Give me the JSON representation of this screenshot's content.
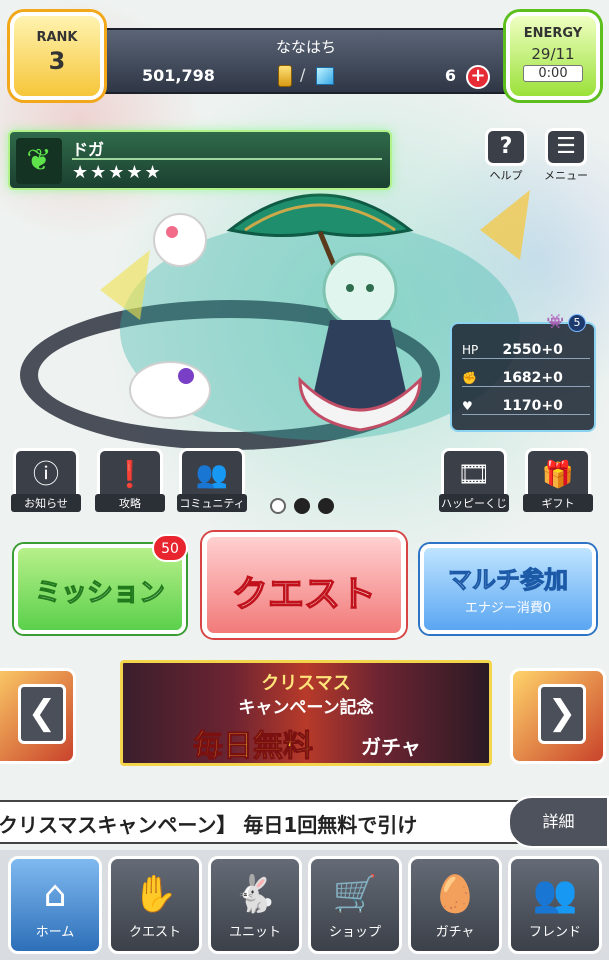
{
  "header": {
    "rank_label": "RANK",
    "rank_value": "3",
    "player_name": "ななはち",
    "money": "501,798",
    "orb_count": "6",
    "plus_symbol": "+",
    "energy_label": "ENERGY",
    "energy_value": "29/11",
    "energy_timer": "0:00"
  },
  "monster": {
    "name": "ドガ",
    "stars": "★★★★★",
    "element_icon": "leaf-icon"
  },
  "top_buttons": {
    "help_label": "ヘルプ",
    "menu_label": "メニュー"
  },
  "stats": {
    "evolution_count": "5",
    "hp_label": "HP",
    "hp_value": "2550+0",
    "attack_value": "1682+0",
    "speed_value": "1170+0"
  },
  "shortcuts": {
    "news_label": "お知らせ",
    "strategy_label": "攻略",
    "community_label": "コミュニティ",
    "happy_lottery_label": "ハッピーくじ",
    "gift_label": "ギフト"
  },
  "main_buttons": {
    "mission_label": "ミッション",
    "mission_badge": "50",
    "quest_label": "クエスト",
    "multi_label": "マルチ参加",
    "multi_sub": "エナジー消費0"
  },
  "banner": {
    "line1": "クリスマス",
    "line2": "キャンペーン記念",
    "line3": "毎日無料",
    "line3b": "ガチャ",
    "prev_symbol": "❮",
    "next_symbol": "❯"
  },
  "ticker": {
    "text": "クリスマスキャンペーン】 毎日1回無料で引け",
    "details_label": "詳細"
  },
  "bottom_nav": [
    {
      "label": "ホーム",
      "icon": "home-icon",
      "active": true
    },
    {
      "label": "クエスト",
      "icon": "handshake-icon",
      "active": false
    },
    {
      "label": "ユニット",
      "icon": "rabbit-icon",
      "active": false
    },
    {
      "label": "ショップ",
      "icon": "cart-icon",
      "active": false
    },
    {
      "label": "ガチャ",
      "icon": "egg-icon",
      "active": false
    },
    {
      "label": "フレンド",
      "icon": "friends-icon",
      "active": false
    }
  ]
}
